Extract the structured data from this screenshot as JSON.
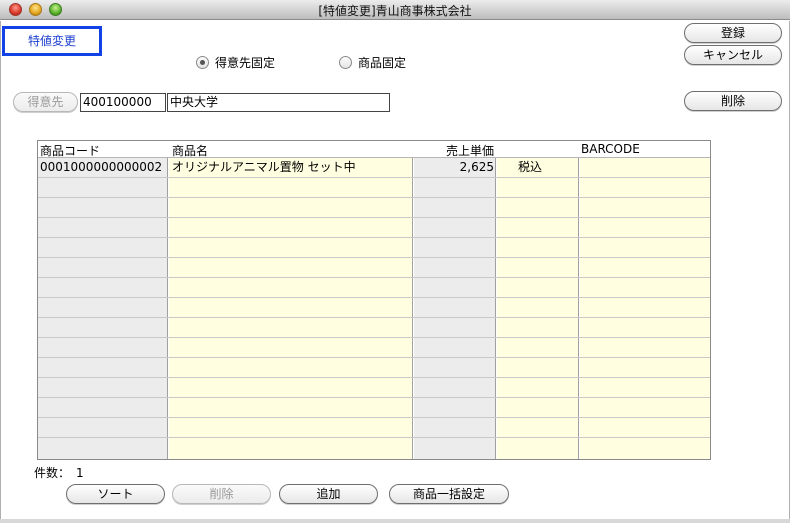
{
  "window": {
    "title": "[特値変更]青山商事株式会社"
  },
  "mode_label": "特値変更",
  "radios": [
    {
      "label": "得意先固定",
      "selected": true
    },
    {
      "label": "商品固定",
      "selected": false
    }
  ],
  "buttons": {
    "register": "登録",
    "cancel": "キャンセル",
    "delete_top": "削除",
    "customer": "得意先"
  },
  "customer": {
    "code": "400100000",
    "name": "中央大学"
  },
  "table": {
    "columns": [
      "商品コード",
      "商品名",
      "売上単価",
      "",
      "BARCODE"
    ],
    "rows": [
      {
        "code": "0001000000000002",
        "name": "オリジナルアニマル置物 セット中",
        "price": "2,625",
        "tax": "税込",
        "barcode": ""
      }
    ]
  },
  "count_label": "件数：",
  "count_value": "1",
  "bottom_buttons": {
    "sort": "ソート",
    "delete": "削除",
    "add": "追加",
    "bulk": "商品一括設定"
  }
}
